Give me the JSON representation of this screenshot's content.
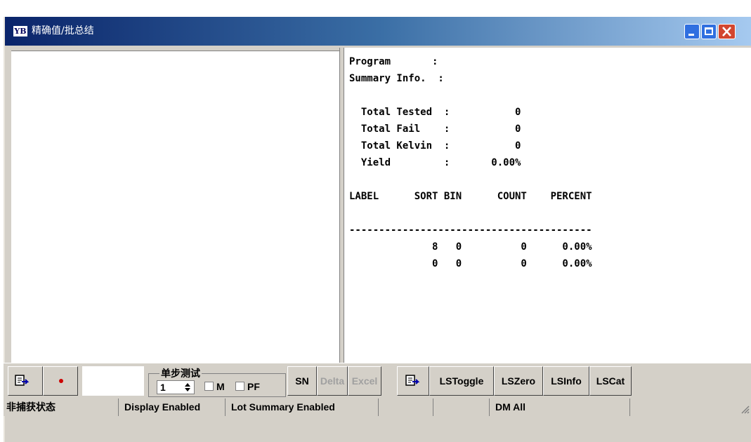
{
  "window": {
    "app_icon": "YB",
    "title": "精确值/批总结",
    "controls": [
      "minimize-icon",
      "maximize-icon",
      "close-icon"
    ]
  },
  "report": {
    "lines": [
      "Program       :",
      "Summary Info.  :",
      "",
      "  Total Tested  :           0",
      "  Total Fail    :           0",
      "  Total Kelvin  :           0",
      "  Yield         :       0.00%",
      "",
      "LABEL      SORT BIN      COUNT    PERCENT",
      "",
      "-----------------------------------------",
      "              8   0          0      0.00%",
      "              0   0          0      0.00%"
    ]
  },
  "toolbar": {
    "group_label": "单步测试",
    "step_value": "1",
    "m_label": "M",
    "pf_label": "PF",
    "m_checked": false,
    "pf_checked": false,
    "sn": "SN",
    "delta": "Delta",
    "excel": "Excel",
    "lstoggle": "LSToggle",
    "lszero": "LSZero",
    "lsinfo": "LSInfo",
    "lscat": "LSCat"
  },
  "status": {
    "capture_state": "非捕获状态",
    "display": "Display Enabled",
    "lot_summary": "Lot Summary Enabled",
    "blank1": "",
    "blank2": "",
    "dm": "DM All"
  },
  "colors": {
    "titlebar_start": "#0a246a",
    "titlebar_end": "#a6caf0",
    "face": "#d4d0c8",
    "close": "#d2462f",
    "record": "#cc0000",
    "disabled_text": "#a0a0a0"
  }
}
